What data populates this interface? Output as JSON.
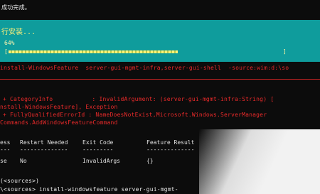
{
  "console": {
    "line_status_top": "成功完成。",
    "panel": {
      "title": "行安装...",
      "percent": "64%",
      "progress_fraction": 0.62,
      "bracket_right": "]"
    },
    "error_lines": [
      "install-WindowsFeature  server-gui-mgmt-infra,server-gui-shell  -source:wim:d:\\so",
      "+ CategoryInfo           : InvalidArgument: (server-gui-mgmt-infra:String) [",
      "nstall-WindowsFeature], Exception",
      "+ FullyQualifiedErrorId : NameDoesNotExist,Microsoft.Windows.ServerManager",
      "Commands.AddWindowsFeatureCommand"
    ],
    "table": {
      "headers": [
        "ess",
        "Restart Needed",
        "Exit Code",
        "Feature Result"
      ],
      "row": [
        "se",
        "No",
        "InvalidArgs",
        "{}"
      ]
    },
    "prompt_lines": [
      "(<sources>)",
      "\\<sources> install-windowsfeature server-gui-mgmt-"
    ]
  },
  "colors": {
    "background": "#0c0c0c",
    "panel": "#0f9c9c",
    "error": "#ea2a2a",
    "text": "#e6e6e6"
  }
}
